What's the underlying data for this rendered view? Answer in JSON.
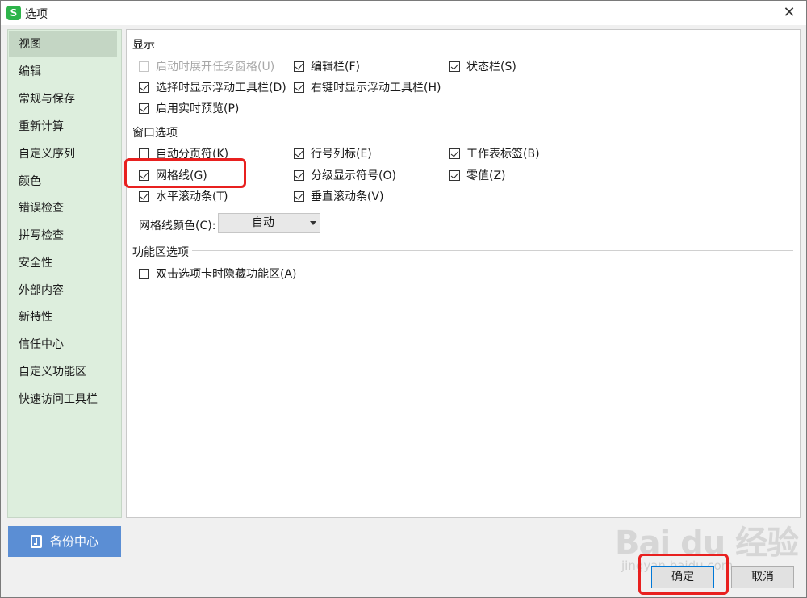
{
  "window": {
    "title": "选项",
    "app_icon_letter": "S",
    "close_glyph": "✕"
  },
  "sidebar": {
    "items": [
      {
        "label": "视图",
        "active": true
      },
      {
        "label": "编辑"
      },
      {
        "label": "常规与保存"
      },
      {
        "label": "重新计算"
      },
      {
        "label": "自定义序列"
      },
      {
        "label": "颜色"
      },
      {
        "label": "错误检查"
      },
      {
        "label": "拼写检查"
      },
      {
        "label": "安全性"
      },
      {
        "label": "外部内容"
      },
      {
        "label": "新特性"
      },
      {
        "label": "信任中心"
      },
      {
        "label": "自定义功能区"
      },
      {
        "label": "快速访问工具栏"
      }
    ],
    "backup_label": "备份中心"
  },
  "sections": {
    "display": {
      "title": "显示",
      "options": [
        {
          "label": "启动时展开任务窗格(U)",
          "checked": false,
          "disabled": true
        },
        {
          "label": "编辑栏(F)",
          "checked": true
        },
        {
          "label": "状态栏(S)",
          "checked": true
        },
        {
          "label": "选择时显示浮动工具栏(D)",
          "checked": true
        },
        {
          "label": "右键时显示浮动工具栏(H)",
          "checked": true
        },
        {
          "label": "启用实时预览(P)",
          "checked": true
        }
      ]
    },
    "window": {
      "title": "窗口选项",
      "options": [
        {
          "label": "自动分页符(K)",
          "checked": false
        },
        {
          "label": "行号列标(E)",
          "checked": true
        },
        {
          "label": "工作表标签(B)",
          "checked": true
        },
        {
          "label": "网格线(G)",
          "checked": true
        },
        {
          "label": "分级显示符号(O)",
          "checked": true
        },
        {
          "label": "零值(Z)",
          "checked": true
        },
        {
          "label": "水平滚动条(T)",
          "checked": true
        },
        {
          "label": "垂直滚动条(V)",
          "checked": true
        }
      ],
      "gridline_color_label": "网格线颜色(C):",
      "gridline_color_value": "自动"
    },
    "ribbon": {
      "title": "功能区选项",
      "options": [
        {
          "label": "双击选项卡时隐藏功能区(A)",
          "checked": false
        }
      ]
    }
  },
  "footer": {
    "ok_label": "确定",
    "cancel_label": "取消"
  },
  "watermark": {
    "brand": "Bai du 经验",
    "url": "jingyan.baidu.com"
  },
  "colors": {
    "highlight": "#e8201f",
    "sidebar_bg": "#ddeedd",
    "backup_button": "#5b8ed4"
  }
}
